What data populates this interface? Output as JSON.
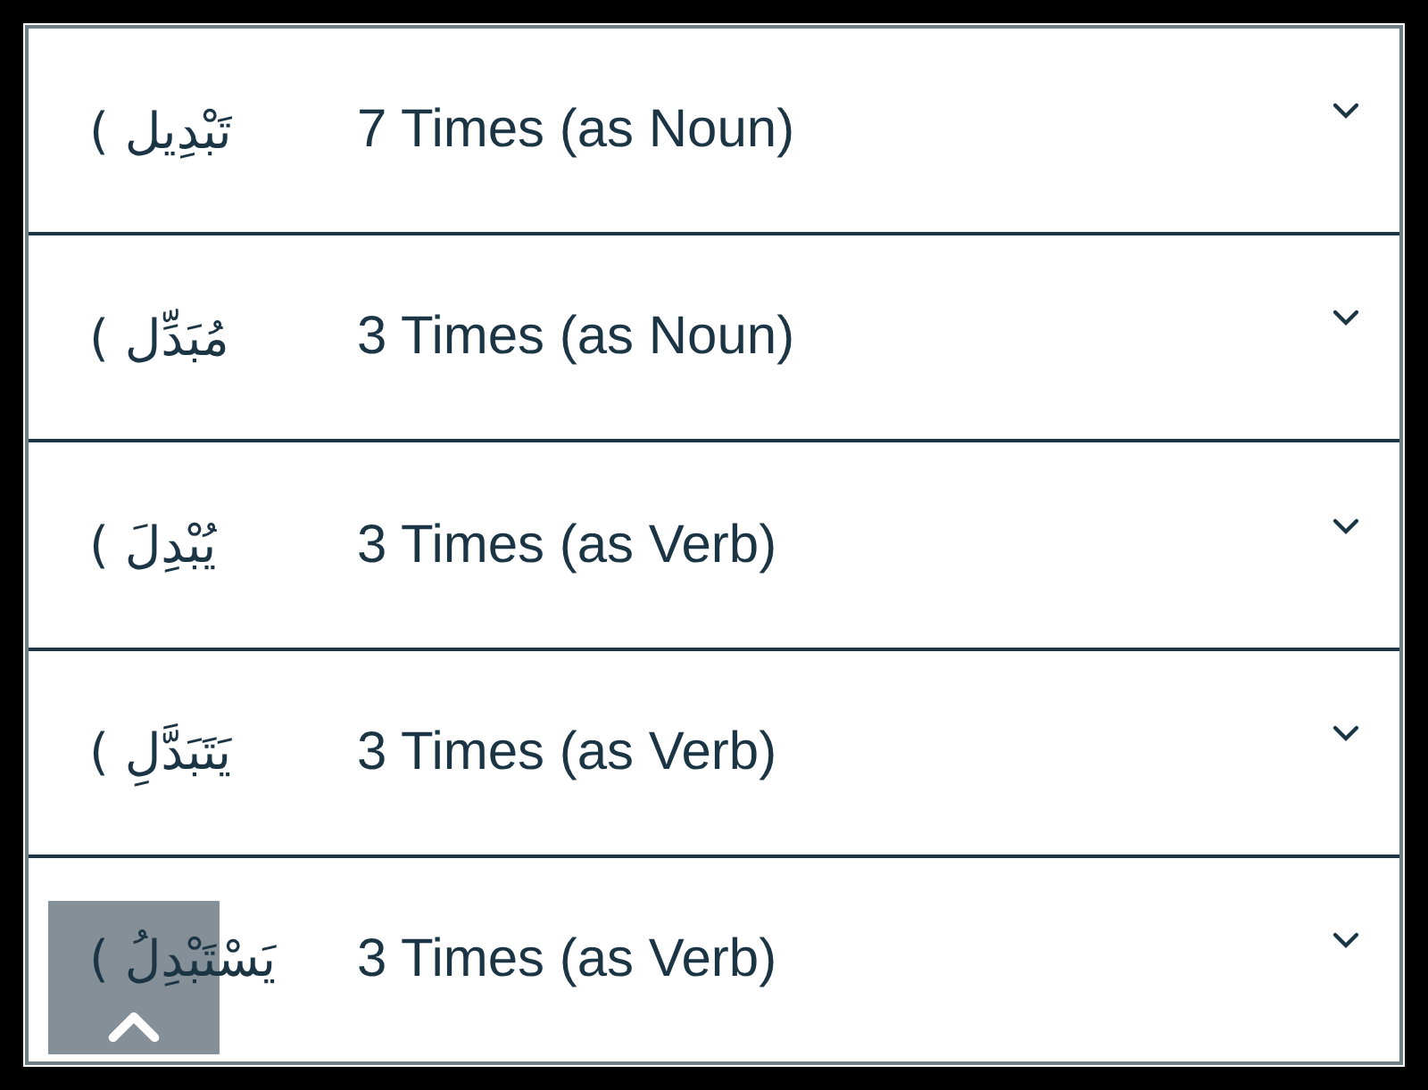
{
  "rows": [
    {
      "word": "( تَبْدِيل",
      "label": "7 Times (as Noun)",
      "expanded": false
    },
    {
      "word": "( مُبَدِّل",
      "label": "3 Times (as Noun)",
      "expanded": false
    },
    {
      "word": "( يُبْدِلَ",
      "label": "3 Times (as Verb)",
      "expanded": false
    },
    {
      "word": "( يَتَبَدَّلِ",
      "label": "3 Times (as Verb)",
      "expanded": false
    },
    {
      "word": "( يَسْتَبْدِلُ",
      "label": "3 Times (as Verb)",
      "expanded": false
    }
  ]
}
